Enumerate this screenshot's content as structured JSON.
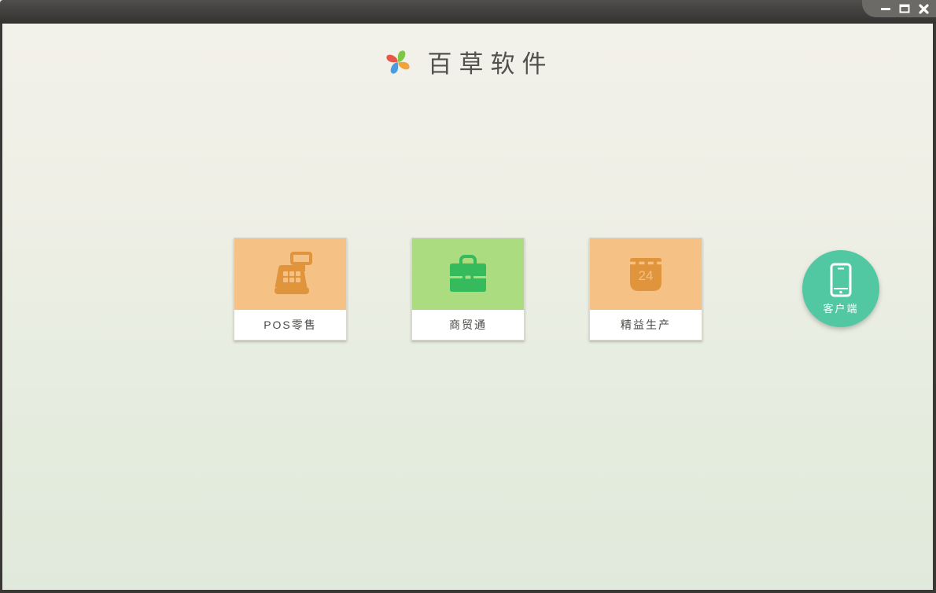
{
  "window": {
    "title_bar": {
      "controls": [
        {
          "name": "minimize",
          "icon": "minimize-icon"
        },
        {
          "name": "maximize",
          "icon": "maximize-icon"
        },
        {
          "name": "close",
          "icon": "close-icon"
        }
      ]
    }
  },
  "header": {
    "app_name": "百草软件",
    "logo": "pinwheel-logo",
    "logo_colors": {
      "top": "#7cc845",
      "right": "#f0a23c",
      "bottom": "#4a9be4",
      "left": "#e8584a"
    }
  },
  "launcher": {
    "cards": [
      {
        "label": "POS零售",
        "icon": "cash-register-icon",
        "bg_color": "#f5c185",
        "icon_color": "#e0953d"
      },
      {
        "label": "商贸通",
        "icon": "briefcase-icon",
        "bg_color": "#abdc80",
        "icon_color": "#35ba5c"
      },
      {
        "label": "精益生产",
        "icon": "calendar-icon",
        "calendar_day": "24",
        "bg_color": "#f5c185",
        "icon_color": "#e0953d"
      }
    ]
  },
  "client_badge": {
    "label": "客户端",
    "icon": "smartphone-icon",
    "bg_color": "#52c8a2"
  },
  "theme": {
    "titlebar_top": "#514f4d",
    "titlebar_bottom": "#343230",
    "controls_tab": "#6b6a67",
    "frame": "#3a3835",
    "bg_top": "#f2f1ea",
    "bg_bottom": "#e0e9db",
    "card_label_text": "#4a4a46",
    "title_text": "#53514b"
  }
}
